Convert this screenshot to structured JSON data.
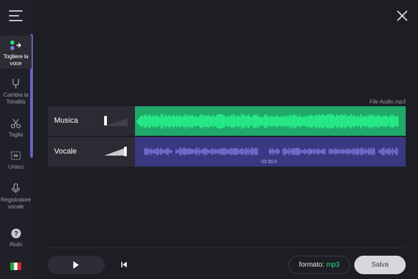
{
  "sidebar": {
    "items": [
      {
        "label": "Togliere la voce",
        "icon": "remove-voice-icon"
      },
      {
        "label": "Cambia la Tonalità",
        "icon": "tuning-fork-icon"
      },
      {
        "label": "Taglia",
        "icon": "scissors-icon"
      },
      {
        "label": "Unisci",
        "icon": "merge-icon"
      },
      {
        "label": "Registratore vocale",
        "icon": "microphone-icon"
      }
    ],
    "help_label": "Aiuto",
    "language_flag": "italy-flag-icon"
  },
  "editor": {
    "file_name": "File Audio.mp3",
    "tracks": [
      {
        "label": "Musica",
        "volume": 0.0,
        "color": "#1fa86a",
        "wave_color": "#28f08a"
      },
      {
        "label": "Vocale",
        "volume": 1.0,
        "color": "#3a3880",
        "wave_color": "#7f7ae0"
      }
    ],
    "time_marker": "03:30.0"
  },
  "footer": {
    "format_label": "formato:",
    "format_value": "mp3",
    "save_label": "Salva"
  },
  "colors": {
    "accent": "#6a64c8",
    "format_value": "#28e07c"
  }
}
